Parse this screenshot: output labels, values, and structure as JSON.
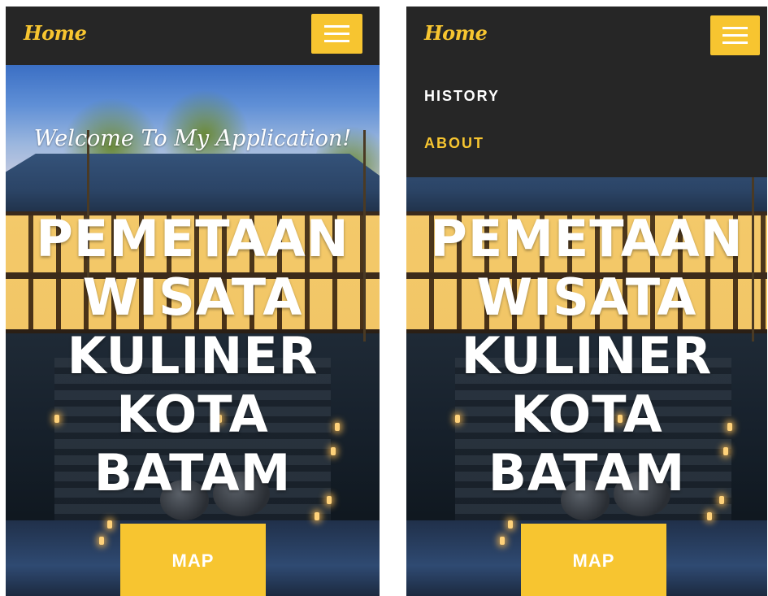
{
  "left_screen": {
    "navbar": {
      "brand": "Home",
      "menu_icon": "hamburger-icon"
    },
    "hero": {
      "welcome": "Welcome To My Application!",
      "headline_lines": [
        "PEMETAAN",
        "WISATA",
        "KULINER",
        "KOTA",
        "BATAM"
      ],
      "map_button": "MAP"
    }
  },
  "right_screen": {
    "navbar": {
      "brand": "Home",
      "menu_icon": "hamburger-icon"
    },
    "dropdown": {
      "items": [
        {
          "label": "HISTORY",
          "color": "#ffffff"
        },
        {
          "label": "ABOUT",
          "color": "#f7c530"
        }
      ]
    },
    "hero": {
      "headline_lines": [
        "PEMETAAN",
        "WISATA",
        "KULINER",
        "KOTA",
        "BATAM"
      ],
      "map_button": "MAP"
    }
  },
  "colors": {
    "accent": "#f7c530",
    "navbar": "#262626",
    "text": "#ffffff"
  }
}
